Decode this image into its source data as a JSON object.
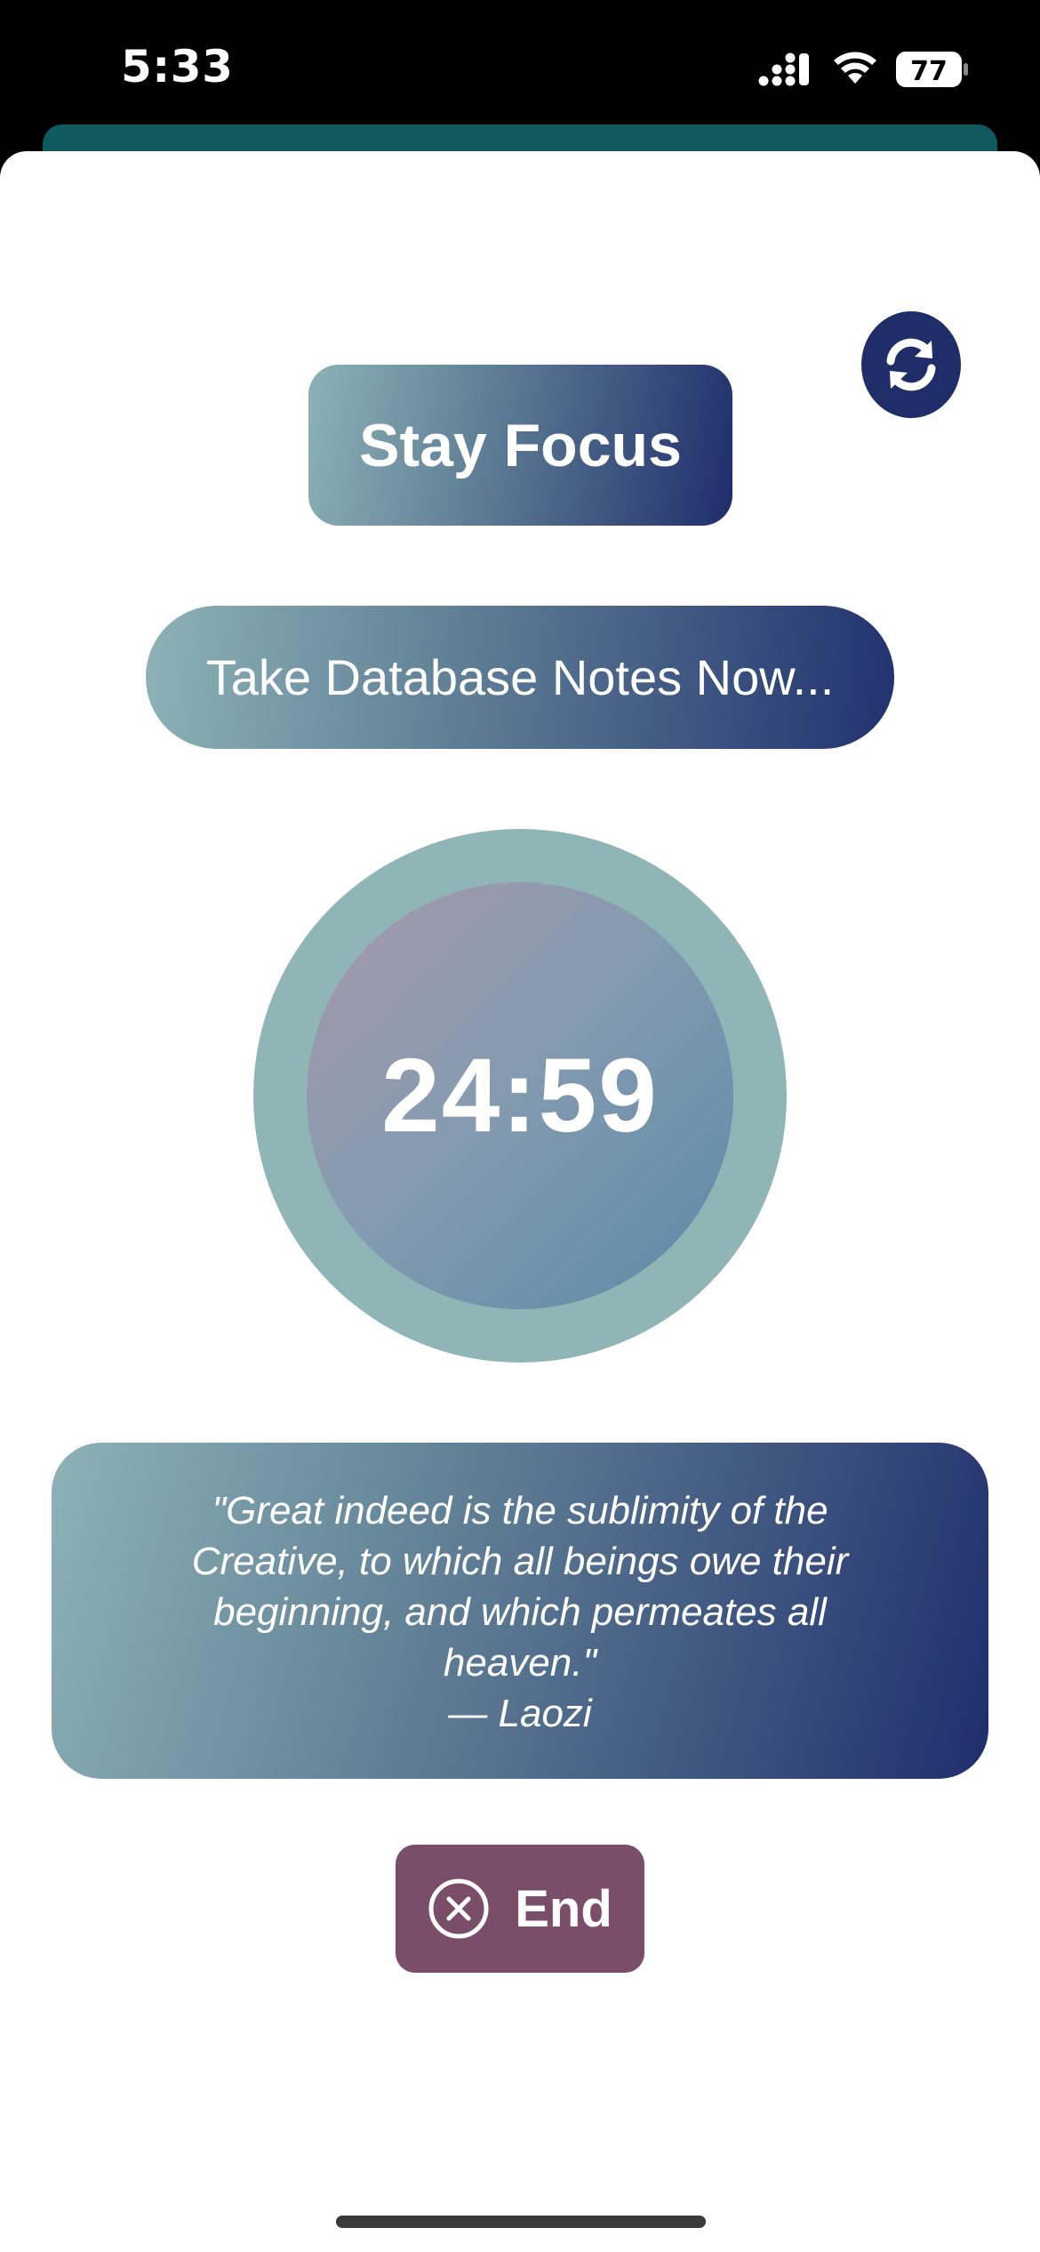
{
  "status_bar": {
    "time": "5:33",
    "battery_level": "77",
    "signal_icon": "cellular-signal-icon",
    "wifi_icon": "wifi-icon",
    "battery_icon": "battery-icon"
  },
  "colors": {
    "sheet_background": "#ffffff",
    "header_strip": "#0f5a5f",
    "refresh_button": "#1f2d68",
    "end_button": "#7a4d68",
    "timer_ring": "#8fb5b6"
  },
  "header": {
    "refresh_icon": "refresh-icon",
    "title": "Stay Focus"
  },
  "task": {
    "label": "Take Database Notes Now..."
  },
  "timer": {
    "display": "24:59"
  },
  "quote": {
    "text": "\"Great indeed is the sublimity of the Creative, to which all beings owe their beginning, and which permeates all heaven.\"",
    "author": "— Laozi"
  },
  "end_button": {
    "icon": "close-circle-icon",
    "label": "End"
  }
}
